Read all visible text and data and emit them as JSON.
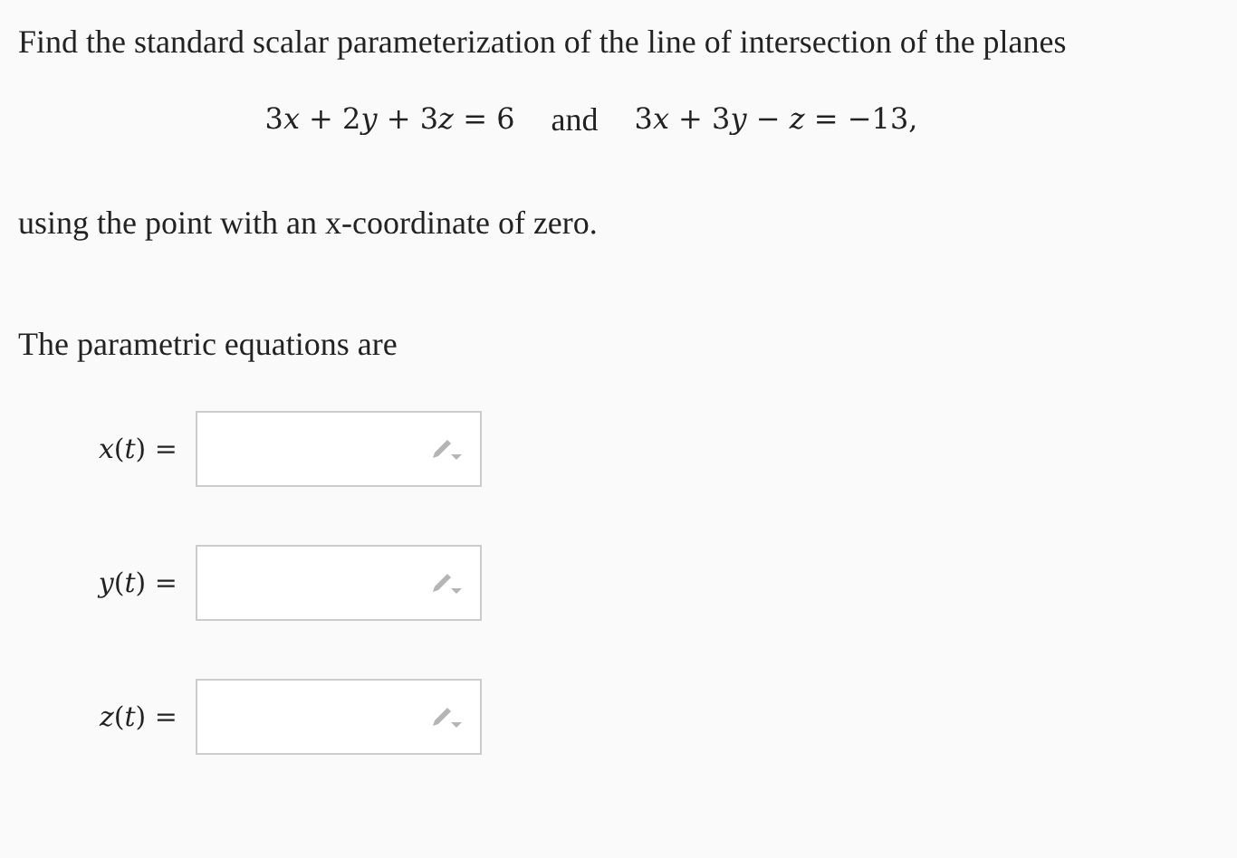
{
  "question": "Find the standard scalar parameterization of the line of intersection of the planes",
  "equations": [
    "3x + 2y + 3z = 6",
    "3x + 3y − z = −13,"
  ],
  "connector": "and",
  "condition": "using the point with an x-coordinate of zero.",
  "answer_intro": "The parametric equations are",
  "answers": [
    {
      "label": "x(t) ="
    },
    {
      "label": "y(t) ="
    },
    {
      "label": "z(t) ="
    }
  ]
}
